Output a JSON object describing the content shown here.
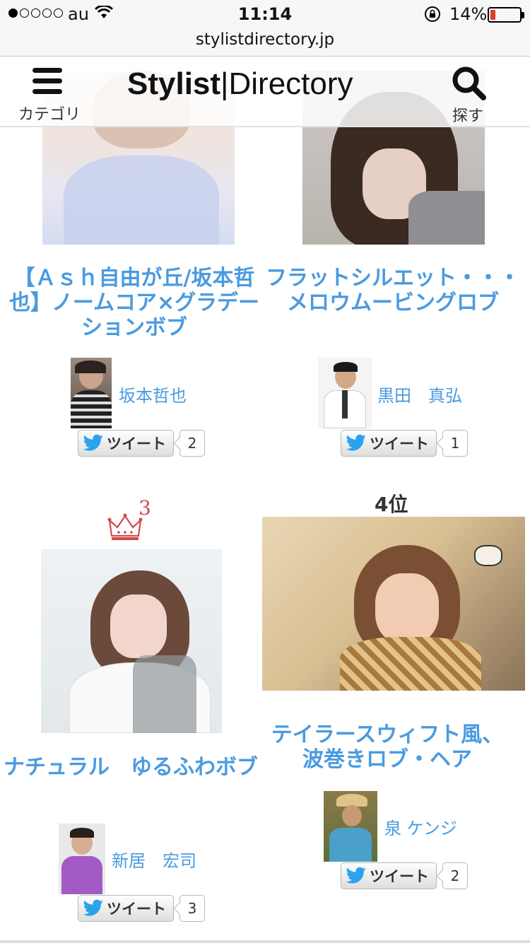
{
  "status": {
    "carrier": "au",
    "time": "11:14",
    "battery": "14%",
    "battery_level": 0.14
  },
  "browser": {
    "url": "stylistdirectory.jp"
  },
  "header": {
    "menu_label": "カテゴリ",
    "logo_bold": "Stylist",
    "logo_sep": "|",
    "logo_rest": "Directory",
    "search_label": "探す"
  },
  "items": [
    {
      "title": "【Ａｓｈ自由が丘/坂本哲也】ノームコア×グラデーションボブ",
      "stylist": "坂本哲也",
      "tweet_label": "ツイート",
      "tweet_count": "2"
    },
    {
      "title": "フラットシルエット・・・メロウムービングロブ",
      "stylist": "黒田　真弘",
      "tweet_label": "ツイート",
      "tweet_count": "1"
    },
    {
      "rank_badge": "3",
      "title": "ナチュラル　ゆるふわボブ",
      "stylist": "新居　宏司",
      "tweet_label": "ツイート",
      "tweet_count": "3"
    },
    {
      "rank_label": "4位",
      "title": "テイラースウィフト風、波巻きロブ・ヘア",
      "stylist": "泉 ケンジ",
      "tweet_label": "ツイート",
      "tweet_count": "2"
    }
  ],
  "colors": {
    "link": "#4a9be0",
    "battery_low": "#e23a2a",
    "crown": "#d24a4a"
  }
}
